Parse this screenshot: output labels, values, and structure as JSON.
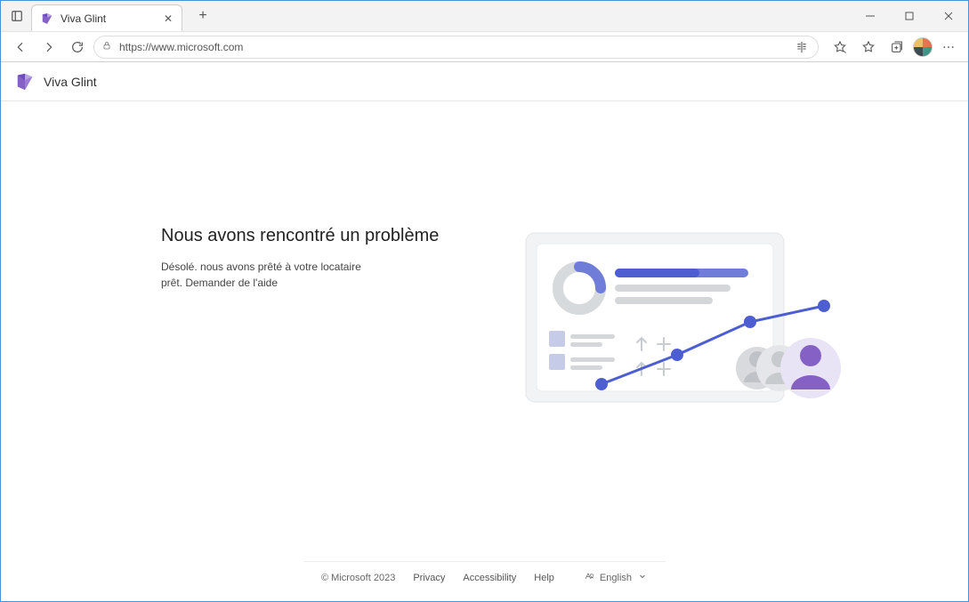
{
  "browser": {
    "tab_title": "Viva Glint",
    "url": "https://www.microsoft.com"
  },
  "app": {
    "title": "Viva Glint"
  },
  "error": {
    "heading": "Nous avons rencontré un problème",
    "line1": "Désolé. nous avons prêté à votre locataire",
    "line2": "prêt. Demander de l'aide"
  },
  "footer": {
    "copyright": "© Microsoft 2023",
    "links": {
      "privacy": "Privacy",
      "accessibility": "Accessibility",
      "help": "Help"
    },
    "language_label": "English"
  }
}
